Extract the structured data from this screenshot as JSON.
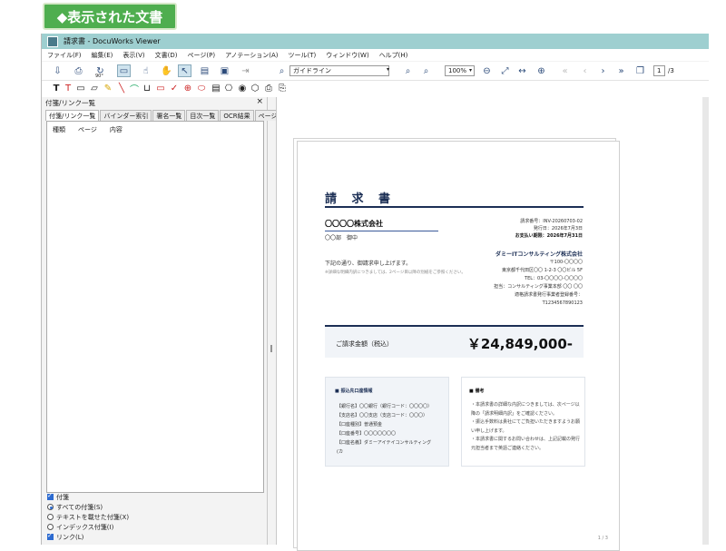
{
  "caption": "◆表示された文書",
  "window": {
    "title": "請求書 - DocuWorks Viewer"
  },
  "menu": [
    "ファイル(F)",
    "編集(E)",
    "表示(V)",
    "文書(D)",
    "ページ(P)",
    "アノテーション(A)",
    "ツール(T)",
    "ウィンドウ(W)",
    "ヘルプ(H)"
  ],
  "toolbar": {
    "guide_combo": "ガイドライン",
    "zoom_combo": "100%",
    "rotate_label": "90°",
    "page_input": "1",
    "page_total": "/3"
  },
  "panel": {
    "title": "付箋/リンク一覧",
    "tabs": [
      "付箋/リンク一覧",
      "バインダー索引",
      "署名一覧",
      "目次一覧",
      "OCR結果",
      "ページ属性"
    ],
    "columns": [
      "種類",
      "ページ",
      "内容"
    ],
    "options": [
      {
        "label": "付箋",
        "type": "check"
      },
      {
        "label": "すべての付箋(S)",
        "type": "radio-on"
      },
      {
        "label": "テキストを載せた付箋(X)",
        "type": "radio"
      },
      {
        "label": "インデックス付箋(I)",
        "type": "radio"
      },
      {
        "label": "リンク(L)",
        "type": "check"
      }
    ]
  },
  "document": {
    "title": "請 求 書",
    "to_company": "〇〇〇〇株式会社",
    "to_dept": "〇〇部　御中",
    "meta": [
      {
        "text": "請求番号：INV-20260703-02",
        "bold": false
      },
      {
        "text": "発行日：2026年7月3日",
        "bold": false
      },
      {
        "text": "お支払い期限：2026年7月31日",
        "bold": true
      }
    ],
    "intro": "下記の通り、御請求申し上げます。",
    "note": "※詳細な明細内訳につきましては、2ページ目以降の別紙をご参照ください。",
    "issuer": {
      "name": "ダミーITコンサルティング株式会社",
      "lines": [
        "〒100-〇〇〇〇",
        "東京都千代田区〇〇 1-2-3 〇〇ビル 5F",
        "TEL：03-〇〇〇〇-〇〇〇〇",
        "担当：コンサルティング事業本部 〇〇 〇〇",
        "適格請求書発行事業者登録番号：",
        "T1234567890123"
      ]
    },
    "amount_label": "ご請求金額（税込）",
    "amount_value": "￥24,849,000-",
    "bank": {
      "heading": "■ 振込先口座情報",
      "rows": [
        "【銀行名】〇〇銀行（銀行コード：〇〇〇〇）",
        "【支店名】〇〇支店（支店コード：〇〇〇）",
        "【口座種別】普通預金",
        "【口座番号】〇〇〇〇〇〇〇",
        "【口座名義】ダミーアイテイコンサルティング",
        "(カ"
      ]
    },
    "memo": {
      "heading": "■ 備考",
      "rows": [
        "・本請求書の詳細な内訳につきましては、次ページ以降の「請求明細内訳」をご確認ください。",
        "・振込手数料は貴社にてご負担いただきますようお願い申し上げます。",
        "・本請求書に関するお問い合わせは、上記記載の発行元担当者まで英語ご連絡ください。"
      ]
    },
    "page_number": "1 / 3"
  },
  "colors": {
    "titlebar": "#9ecfd0",
    "caption_bg": "#4fae4f",
    "doc_navy": "#1c2f55"
  }
}
